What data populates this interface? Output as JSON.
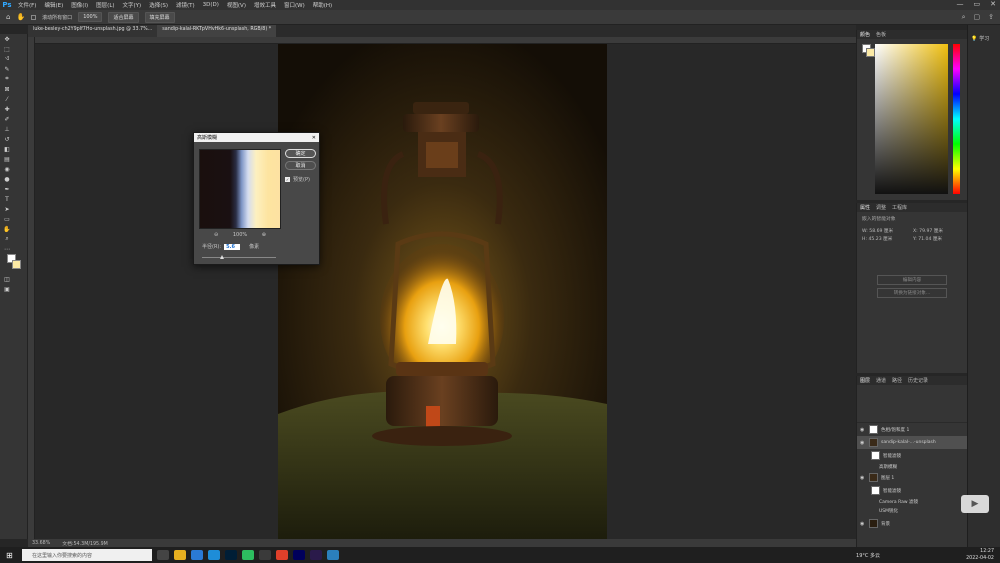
{
  "menu": {
    "items": [
      "文件(F)",
      "编辑(E)",
      "图像(I)",
      "图层(L)",
      "文字(Y)",
      "选择(S)",
      "滤镜(T)",
      "3D(D)",
      "视图(V)",
      "增效工具",
      "窗口(W)",
      "帮助(H)"
    ]
  },
  "options": {
    "scroll_all": "滚动所有窗口",
    "zoom": "100%",
    "fit_screen": "适合屏幕",
    "fill_screen": "填充屏幕"
  },
  "document": {
    "tab1": "luke-besley-ch2Y9pIf7Ho-unsplash.jpg @ 33.7%...",
    "tab2": "sandip-kalal-RKTpVHvHk6-unsplash, RGB/8) *",
    "status_zoom": "33.68%",
    "status_doc": "文档:54.3M/195.9M"
  },
  "dialog": {
    "title": "高斯模糊",
    "ok": "确定",
    "cancel": "取消",
    "preview_label": "预览(P)",
    "zoom": "100%",
    "radius_label": "半径(R):",
    "radius_value": "5.6",
    "radius_unit": "像素"
  },
  "panels": {
    "color_tab": "颜色",
    "swatch_tab": "色板",
    "props_tab": "属性",
    "adjust_tab": "调整",
    "lib_tab": "工程库",
    "props_title": "嵌入的智能对象",
    "w_label": "W:",
    "w_value": "58.69 厘米",
    "h_label": "H:",
    "h_value": "45.23 厘米",
    "x_label": "X:",
    "x_value": "79.97 厘米",
    "y_label": "Y:",
    "y_value": "71.04 厘米",
    "btn_edit": "编辑内容",
    "btn_convert": "转换为链接对象...",
    "layers_tab": "图层",
    "channels_tab": "通道",
    "paths_tab": "路径",
    "history_tab": "历史记录",
    "layers": [
      {
        "name": "色相/饱和度 1"
      },
      {
        "name": "sandip-kalal-...-unsplash"
      },
      {
        "name": "智能滤镜"
      },
      {
        "name": "高斯模糊"
      },
      {
        "name": "图层 1"
      },
      {
        "name": "智能滤镜"
      },
      {
        "name": "Camera Raw 滤镜"
      },
      {
        "name": "USM锐化"
      },
      {
        "name": "背景"
      }
    ]
  },
  "farright": {
    "learn": "学习"
  },
  "taskbar": {
    "search_placeholder": "在这里输入你要搜索的内容",
    "weather": "19°C 多云",
    "time": "12:27",
    "date": "2022-04-02"
  }
}
